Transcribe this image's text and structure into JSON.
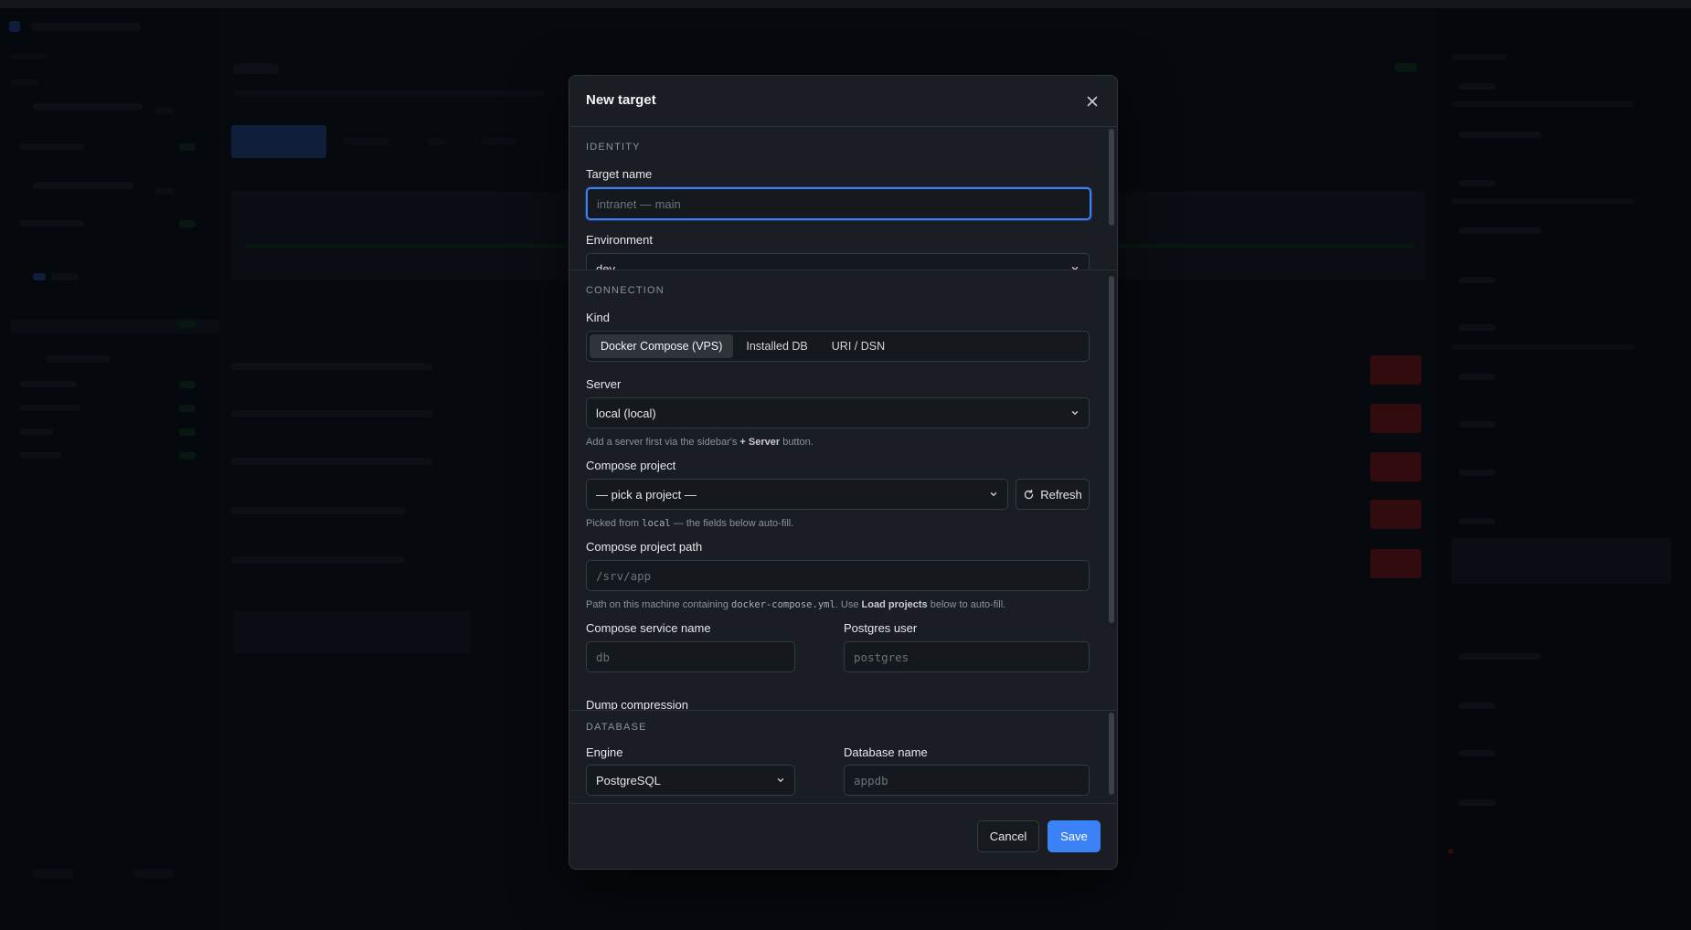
{
  "modal": {
    "title": "New target",
    "close_icon": "close-icon"
  },
  "identity": {
    "section_label": "IDENTITY",
    "target_name_label": "Target name",
    "target_name_placeholder": "intranet — main",
    "environment_label": "Environment",
    "environment_value": "dev"
  },
  "connection": {
    "section_label": "CONNECTION",
    "kind_label": "Kind",
    "kind_options": [
      {
        "label": "Docker Compose (VPS)",
        "active": true
      },
      {
        "label": "Installed DB",
        "active": false
      },
      {
        "label": "URI / DSN",
        "active": false
      }
    ],
    "server_label": "Server",
    "server_value": "local (local)",
    "server_help_prefix": "Add a server first via the sidebar's ",
    "server_help_bold": "+ Server",
    "server_help_suffix": " button.",
    "compose_project_label": "Compose project",
    "compose_project_value": "— pick a project —",
    "refresh_label": "Refresh",
    "compose_help_prefix": "Picked from ",
    "compose_help_code": "local",
    "compose_help_suffix": " — the fields below auto-fill.",
    "compose_path_label": "Compose project path",
    "compose_path_placeholder": "/srv/app",
    "path_help_prefix": "Path on this machine containing ",
    "path_help_code": "docker-compose.yml",
    "path_help_mid": ". Use ",
    "path_help_bold": "Load projects",
    "path_help_suffix": " below to auto-fill.",
    "service_name_label": "Compose service name",
    "service_name_placeholder": "db",
    "postgres_user_label": "Postgres user",
    "postgres_user_placeholder": "postgres",
    "dump_compression_label": "Dump compression"
  },
  "database": {
    "section_label": "DATABASE",
    "engine_label": "Engine",
    "engine_value": "PostgreSQL",
    "db_name_label": "Database name",
    "db_name_placeholder": "appdb"
  },
  "footer": {
    "cancel_label": "Cancel",
    "save_label": "Save"
  },
  "colors": {
    "accent": "#3b82f6",
    "modal_bg": "#1a1d23",
    "page_bg": "#0c1017"
  }
}
